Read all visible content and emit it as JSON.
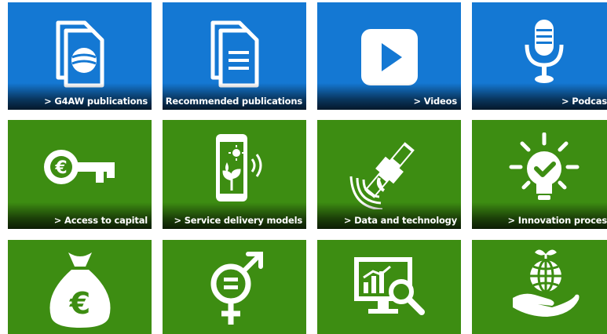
{
  "colors": {
    "blue": "#1478d3",
    "green": "#3d8d12",
    "icon": "#ffffff"
  },
  "tiles": [
    {
      "label": "> G4AW publications",
      "icon": "document-globe-icon"
    },
    {
      "label": "> Recommended publications",
      "icon": "documents-icon"
    },
    {
      "label": "> Videos",
      "icon": "play-icon"
    },
    {
      "label": "> Podcas",
      "icon": "microphone-icon"
    },
    {
      "label": "> Access to capital",
      "icon": "euro-key-icon"
    },
    {
      "label": "> Service delivery models",
      "icon": "smartphone-plant-icon"
    },
    {
      "label": "> Data and technology",
      "icon": "satellite-icon"
    },
    {
      "label": "> Innovation proces",
      "icon": "lightbulb-check-icon"
    },
    {
      "label": "",
      "icon": "money-bag-euro-icon"
    },
    {
      "label": "",
      "icon": "gender-equality-icon"
    },
    {
      "label": "",
      "icon": "monitor-analytics-icon"
    },
    {
      "label": "",
      "icon": "hand-globe-plant-icon"
    }
  ]
}
